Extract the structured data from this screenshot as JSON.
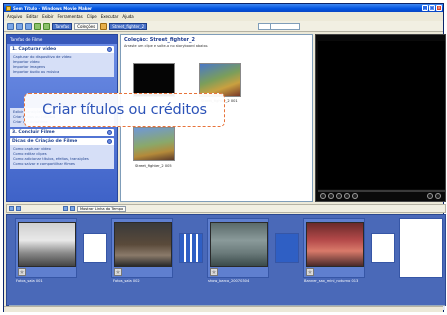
{
  "window": {
    "title": "Sem Título - Windows Movie Maker",
    "buttons": [
      "_",
      "□",
      "×"
    ]
  },
  "menu": [
    "Arquivo",
    "Editar",
    "Exibir",
    "Ferramentas",
    "Clipe",
    "Executar",
    "Ajuda"
  ],
  "toolbar": {
    "tasks_label": "Tarefas",
    "collections_label": "Coleções",
    "collection_select": "Street_fighter_2"
  },
  "tasks_pane": {
    "header": "Tarefas de Filme",
    "sections": [
      {
        "title": "1. Capturar vídeo",
        "items": [
          "Capturar do dispositivo de vídeo",
          "Importar vídeo",
          "Importar imagens",
          "Importar áudio ou música"
        ]
      },
      {
        "title": "2.",
        "items": [
          "Exibir transições de vídeo",
          "Criar títulos ou créditos",
          "Criar um AutoFilme"
        ]
      },
      {
        "title": "3. Concluir Filme",
        "items": []
      },
      {
        "title": "Dicas de Criação de Filme",
        "items": [
          "Como capturar vídeo",
          "Como editar clipes",
          "Como adicionar títulos, efeitos, transições",
          "Como salvar e compartilhar filmes"
        ]
      }
    ]
  },
  "collection": {
    "title": "Coleção: Street_fighter_2",
    "subtitle": "Arraste um clipe e solte-o no storyboard abaixo.",
    "clips": [
      {
        "label": "Street_fighter_2 003"
      },
      {
        "label": "Street_fighter_2 001"
      },
      {
        "label": "Street_fighter_2 005"
      }
    ]
  },
  "callout": {
    "text": "Criar títulos ou créditos"
  },
  "storyboard": {
    "toolbar_label": "Mostrar Linha do Tempo",
    "clips": [
      {
        "label": "Fotos_sala 001"
      },
      {
        "label": "Fotos_sala 002"
      },
      {
        "label": "show_barco_20070304"
      },
      {
        "label": "Banner_sax_mini_noturno 013"
      }
    ]
  }
}
